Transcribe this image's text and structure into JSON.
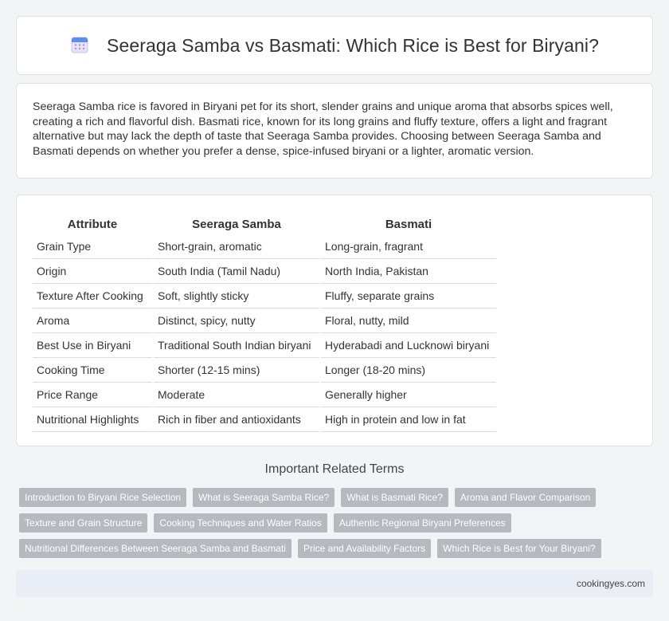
{
  "header": {
    "title": "Seeraga Samba vs Basmati: Which Rice is Best for Biryani?",
    "icon": "calendar-icon"
  },
  "intro": {
    "text": "Seeraga Samba rice is favored in Biryani pet for its short, slender grains and unique aroma that absorbs spices well, creating a rich and flavorful dish. Basmati rice, known for its long grains and fluffy texture, offers a light and fragrant alternative but may lack the depth of taste that Seeraga Samba provides. Choosing between Seeraga Samba and Basmati depends on whether you prefer a dense, spice-infused biryani or a lighter, aromatic version."
  },
  "table": {
    "headers": [
      "Attribute",
      "Seeraga Samba",
      "Basmati"
    ],
    "rows": [
      [
        "Grain Type",
        "Short-grain, aromatic",
        "Long-grain, fragrant"
      ],
      [
        "Origin",
        "South India (Tamil Nadu)",
        "North India, Pakistan"
      ],
      [
        "Texture After Cooking",
        "Soft, slightly sticky",
        "Fluffy, separate grains"
      ],
      [
        "Aroma",
        "Distinct, spicy, nutty",
        "Floral, nutty, mild"
      ],
      [
        "Best Use in Biryani",
        "Traditional South Indian biryani",
        "Hyderabadi and Lucknowi biryani"
      ],
      [
        "Cooking Time",
        "Shorter (12-15 mins)",
        "Longer (18-20 mins)"
      ],
      [
        "Price Range",
        "Moderate",
        "Generally higher"
      ],
      [
        "Nutritional Highlights",
        "Rich in fiber and antioxidants",
        "High in protein and low in fat"
      ]
    ]
  },
  "related": {
    "title": "Important Related Terms",
    "rows": [
      [
        "Introduction to Biryani Rice Selection",
        "What is Seeraga Samba Rice?",
        "What is Basmati Rice?",
        "Aroma and Flavor Comparison"
      ],
      [
        "Texture and Grain Structure",
        "Cooking Techniques and Water Ratios",
        "Authentic Regional Biryani Preferences"
      ],
      [
        "Nutritional Differences Between Seeraga Samba and Basmati",
        "Price and Availability Factors",
        "Which Rice is Best for Your Biryani?"
      ]
    ]
  },
  "footer": {
    "site": "cookingyes.com"
  }
}
